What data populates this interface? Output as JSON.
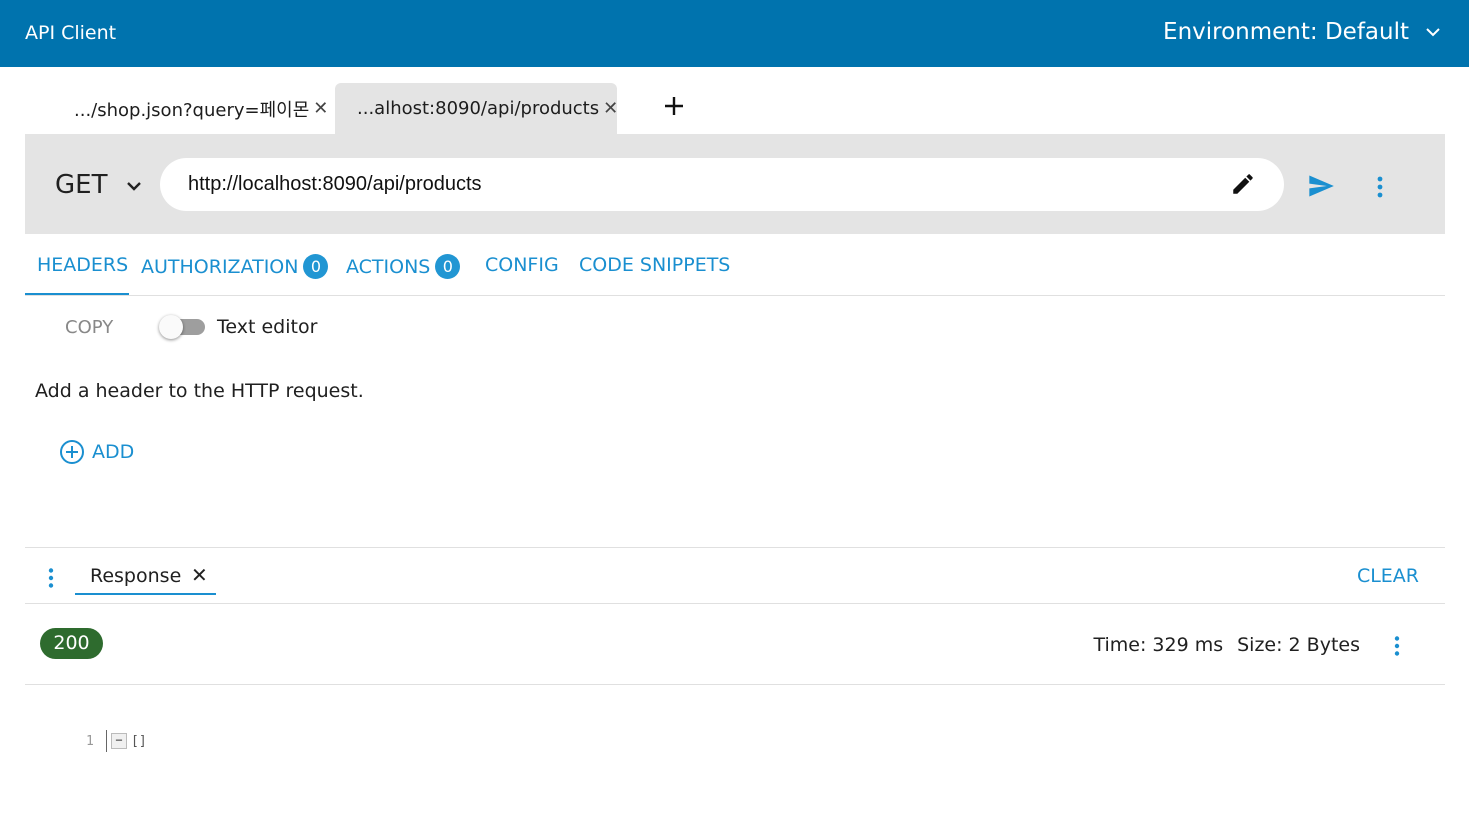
{
  "header": {
    "app_title": "API Client",
    "environment_label": "Environment: Default"
  },
  "tabs": [
    {
      "label": ".../shop.json?query=페이몬",
      "active": false
    },
    {
      "label": "...alhost:8090/api/products",
      "active": true
    }
  ],
  "request": {
    "method": "GET",
    "url": "http://localhost:8090/api/products"
  },
  "request_tabs": {
    "headers": "HEADERS",
    "authorization": "AUTHORIZATION",
    "authorization_count": "0",
    "actions": "ACTIONS",
    "actions_count": "0",
    "config": "CONFIG",
    "code_snippets": "CODE SNIPPETS"
  },
  "headers_panel": {
    "copy_label": "COPY",
    "text_editor_label": "Text editor",
    "text_editor_enabled": false,
    "hint": "Add a header to the HTTP request.",
    "add_label": "ADD"
  },
  "response": {
    "tab_label": "Response",
    "clear_label": "CLEAR",
    "status": "200",
    "time": "Time: 329 ms",
    "size": "Size: 2 Bytes",
    "body_line_number": "1",
    "fold_symbol": "−",
    "body_text": "[]"
  },
  "colors": {
    "header_bg": "#0073ae",
    "accent": "#1a8fd0",
    "status_ok": "#2e6b2e"
  },
  "icons": [
    "chevron-down-icon",
    "close-icon",
    "plus-icon",
    "pencil-icon",
    "send-icon",
    "more-vert-icon",
    "add-circle-icon"
  ]
}
